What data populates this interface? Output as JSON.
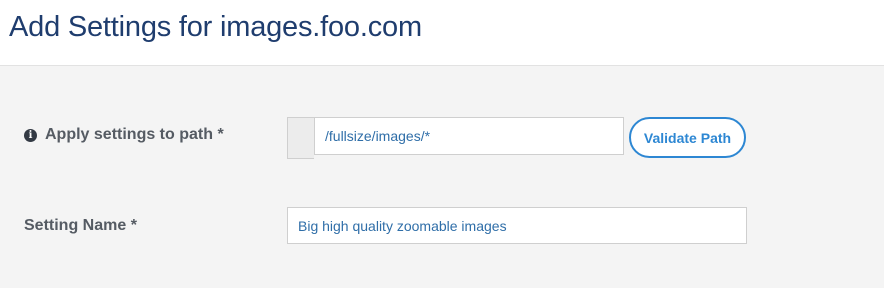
{
  "header": {
    "title": "Add Settings for images.foo.com"
  },
  "form": {
    "path": {
      "label": "Apply settings to path *",
      "info_icon": "info-circle-icon",
      "value": "/fullsize/images/*",
      "validate_button": "Validate Path"
    },
    "setting_name": {
      "label": "Setting Name *",
      "value": "Big high quality zoomable images"
    }
  },
  "colors": {
    "title": "#1f3d6e",
    "accent": "#2d87d3",
    "input_text": "#2f6ea8",
    "label": "#555b63"
  }
}
